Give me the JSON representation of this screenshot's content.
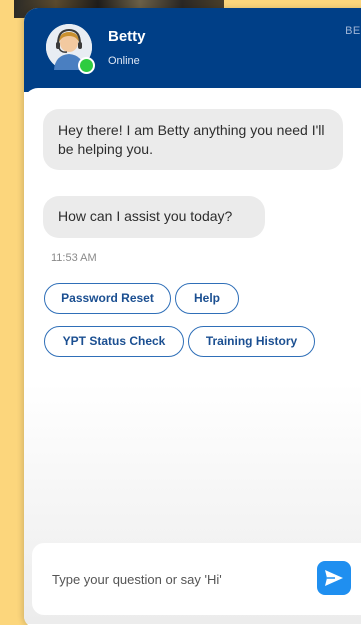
{
  "colors": {
    "background": "#fcd67c",
    "header": "#003f87",
    "bubble": "#ebebeb",
    "chip_border": "#2f6fb8",
    "chip_text": "#1b4f91",
    "send_button": "#1f8ff0",
    "online": "#2ecc40"
  },
  "header": {
    "name": "Betty",
    "status": "Online",
    "badge": "BETA",
    "avatar_icon": "headset-agent-avatar-icon",
    "status_icon": "online-dot-icon"
  },
  "messages": [
    {
      "text": "Hey there! I am Betty anything you need I'll be helping you."
    },
    {
      "text": "How can I assist you today?"
    }
  ],
  "timestamp": "11:53 AM",
  "quick_replies": [
    {
      "label": "Password Reset"
    },
    {
      "label": "Help"
    },
    {
      "label": "YPT Status Check"
    },
    {
      "label": "Training History"
    }
  ],
  "composer": {
    "placeholder": "Type your question or say 'Hi'",
    "send_icon": "send-arrow-icon"
  }
}
